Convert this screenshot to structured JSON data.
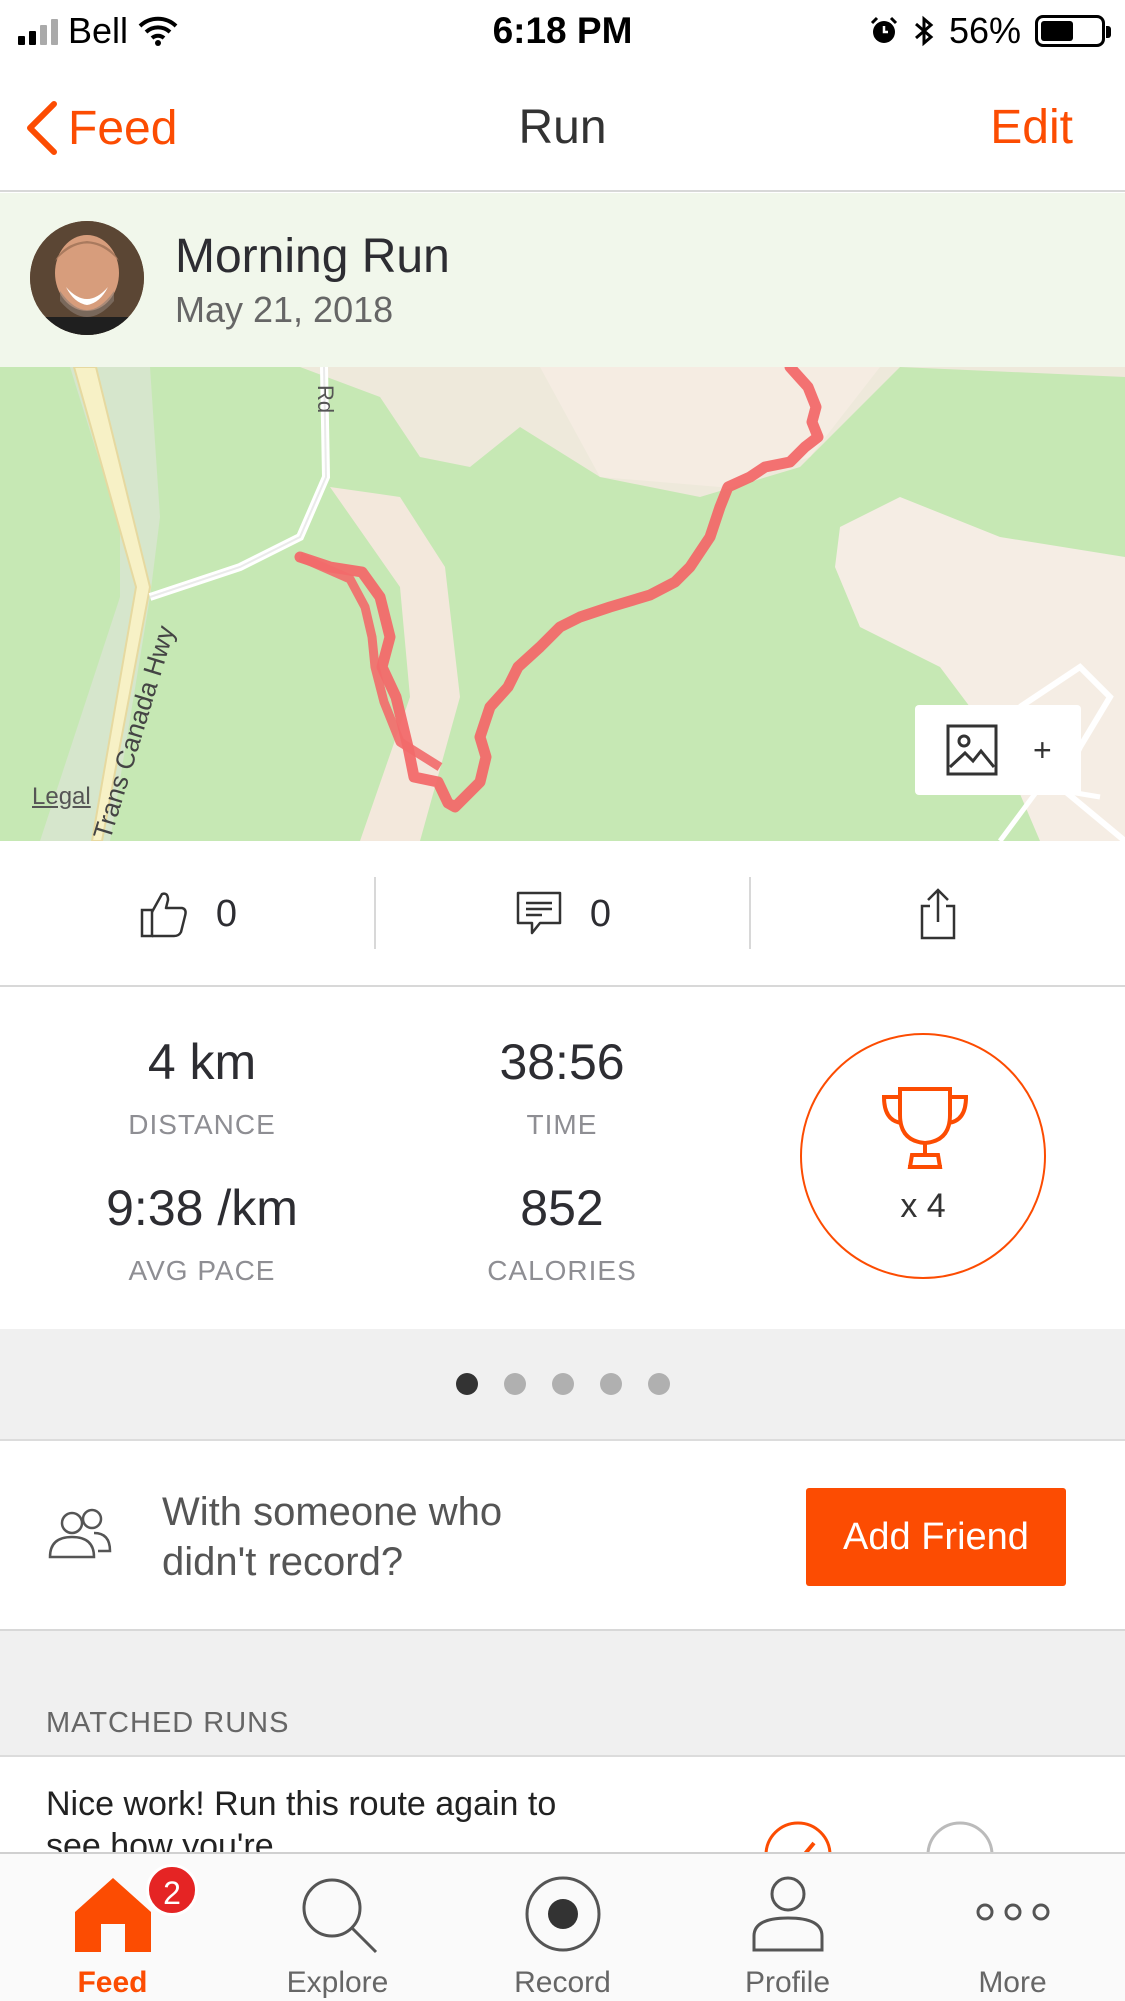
{
  "status_bar": {
    "carrier": "Bell",
    "time": "6:18 PM",
    "battery": "56%",
    "battery_level": 0.56
  },
  "nav": {
    "back_label": "Feed",
    "title": "Run",
    "edit_label": "Edit"
  },
  "activity": {
    "name": "Morning Run",
    "date": "May 21, 2018"
  },
  "map": {
    "road_label_1": "Trans Canada Hwy",
    "road_label_2": "Rd",
    "legal": "Legal",
    "add_photo_label": "+"
  },
  "social": {
    "kudos_count": "0",
    "comments_count": "0"
  },
  "stats": {
    "distance": {
      "value": "4 km",
      "label": "DISTANCE"
    },
    "time": {
      "value": "38:56",
      "label": "TIME"
    },
    "pace": {
      "value": "9:38 /km",
      "label": "AVG PACE"
    },
    "calories": {
      "value": "852",
      "label": "CALORIES"
    },
    "achievements": "x 4"
  },
  "pager": {
    "total": 5,
    "active_index": 0
  },
  "friend": {
    "question": "With someone who didn't record?",
    "button": "Add Friend"
  },
  "matched": {
    "header": "MATCHED RUNS",
    "text": "Nice work! Run this route again to see how you're"
  },
  "tabs": [
    {
      "label": "Feed",
      "icon": "home-icon",
      "badge": "2"
    },
    {
      "label": "Explore",
      "icon": "search-icon"
    },
    {
      "label": "Record",
      "icon": "record-icon"
    },
    {
      "label": "Profile",
      "icon": "profile-icon"
    },
    {
      "label": "More",
      "icon": "more-icon"
    }
  ],
  "colors": {
    "accent": "#fc4c02",
    "route": "#f26a6a",
    "map_green": "#c6e8b4",
    "badge": "#e52424"
  }
}
